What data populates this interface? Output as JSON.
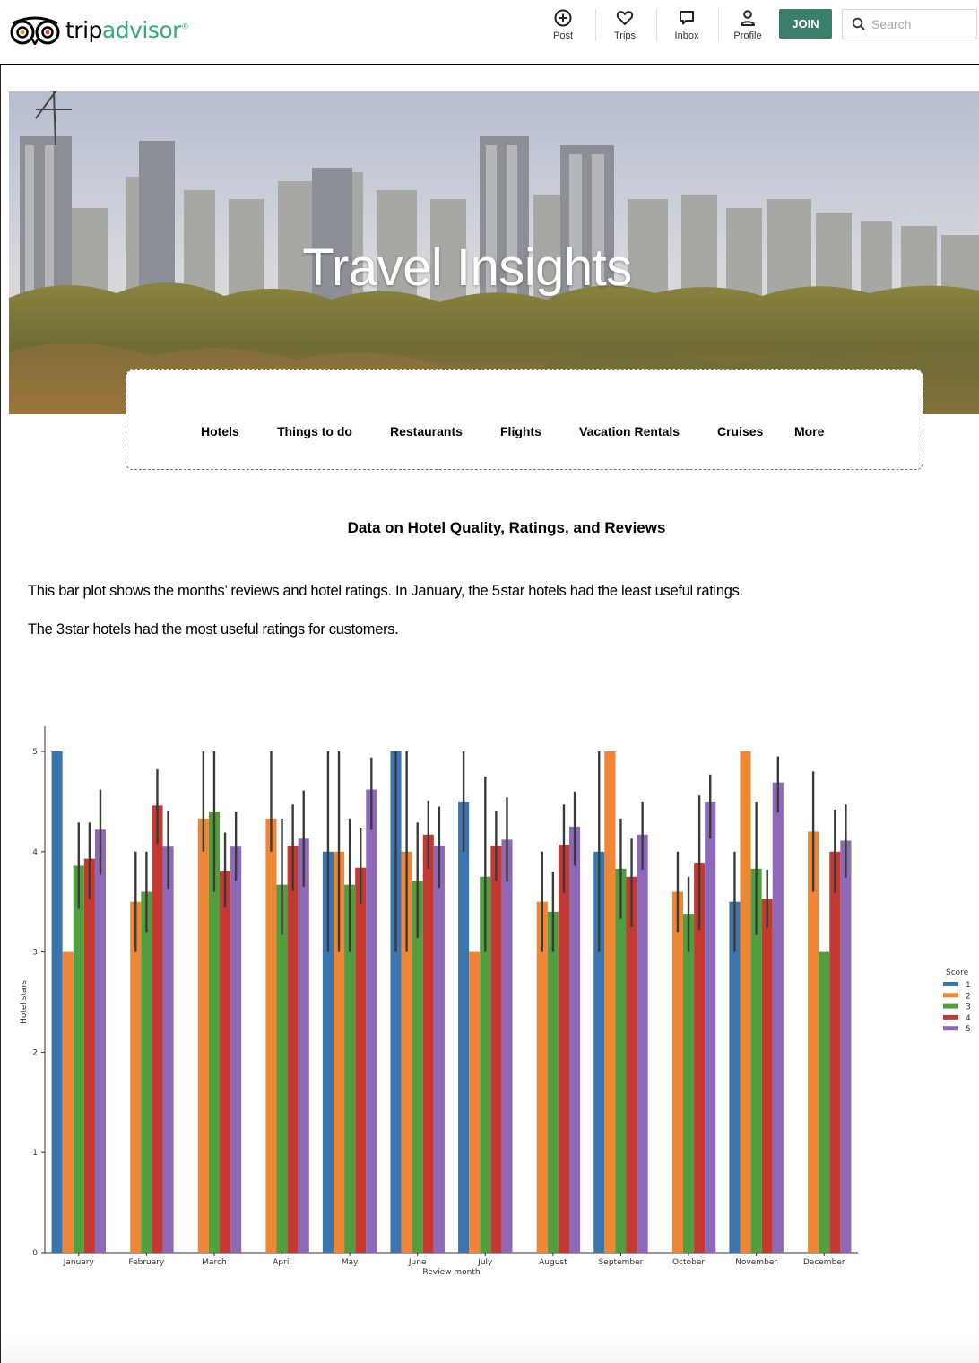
{
  "brand": {
    "name_part1": "trip",
    "name_part2": "advisor",
    "reg": "®"
  },
  "header": {
    "nav": [
      {
        "label": "Post",
        "icon": "post-plus-icon"
      },
      {
        "label": "Trips",
        "icon": "heart-icon"
      },
      {
        "label": "Inbox",
        "icon": "chat-icon"
      },
      {
        "label": "Profile",
        "icon": "user-icon"
      }
    ],
    "join_label": "JOIN",
    "search_placeholder": "Search"
  },
  "hero": {
    "title": "Travel Insights"
  },
  "categories": [
    "Hotels",
    "Things to do",
    "Restaurants",
    "Flights",
    "Vacation Rentals",
    "Cruises",
    "More"
  ],
  "section": {
    "title": "Data on Hotel Quality, Ratings, and Reviews",
    "para1": "This bar plot shows the months’ reviews and hotel ratings.  In January, the 5 star hotels had the least useful ratings.",
    "para2": "The 3 star hotels had the most useful ratings for customers."
  },
  "chart_data": {
    "type": "bar",
    "xlabel": "Review month",
    "ylabel": "Hotel stars",
    "ylim": [
      0,
      5
    ],
    "yticks": [
      0,
      1,
      2,
      3,
      4,
      5
    ],
    "legend_title": "Score",
    "legend_position": "right",
    "error_bars": true,
    "categories": [
      "January",
      "February",
      "March",
      "April",
      "May",
      "June",
      "July",
      "August",
      "September",
      "October",
      "November",
      "December"
    ],
    "series": [
      {
        "name": "1",
        "color": "#3b75af",
        "values": [
          5.0,
          null,
          null,
          null,
          4.0,
          5.0,
          4.5,
          null,
          4.0,
          null,
          3.5,
          null
        ],
        "err_low": [
          null,
          null,
          null,
          null,
          3.0,
          3.0,
          4.0,
          null,
          3.0,
          null,
          3.0,
          null
        ],
        "err_high": [
          null,
          null,
          null,
          null,
          5.0,
          5.0,
          5.0,
          null,
          5.0,
          null,
          4.0,
          null
        ]
      },
      {
        "name": "2",
        "color": "#ef8636",
        "values": [
          3.0,
          3.5,
          4.33,
          4.33,
          4.0,
          4.0,
          3.0,
          3.5,
          5.0,
          3.6,
          5.0,
          4.2
        ],
        "err_low": [
          null,
          3.0,
          4.0,
          4.0,
          3.0,
          3.0,
          null,
          3.0,
          null,
          3.2,
          null,
          3.6
        ],
        "err_high": [
          null,
          4.0,
          5.0,
          5.0,
          5.0,
          5.0,
          null,
          4.0,
          null,
          4.0,
          null,
          4.8
        ]
      },
      {
        "name": "3",
        "color": "#519e3e",
        "values": [
          3.86,
          3.6,
          4.4,
          3.67,
          3.67,
          3.71,
          3.75,
          3.4,
          3.83,
          3.38,
          3.83,
          3.0
        ],
        "err_low": [
          3.43,
          3.2,
          3.6,
          3.17,
          3.0,
          3.14,
          3.0,
          3.0,
          3.33,
          3.0,
          3.17,
          null
        ],
        "err_high": [
          4.29,
          4.0,
          5.0,
          4.33,
          4.33,
          4.29,
          4.75,
          3.8,
          4.33,
          3.75,
          4.5,
          null
        ]
      },
      {
        "name": "4",
        "color": "#c43a32",
        "values": [
          3.93,
          4.46,
          3.81,
          4.06,
          3.84,
          4.17,
          4.06,
          4.07,
          3.75,
          3.89,
          3.53,
          4.0
        ],
        "err_low": [
          3.53,
          4.08,
          3.44,
          3.61,
          3.48,
          3.83,
          3.71,
          3.59,
          3.25,
          3.22,
          3.24,
          3.59
        ],
        "err_high": [
          4.29,
          4.82,
          4.19,
          4.47,
          4.24,
          4.51,
          4.41,
          4.47,
          4.13,
          4.56,
          3.82,
          4.42
        ]
      },
      {
        "name": "5",
        "color": "#8d69b8",
        "values": [
          4.22,
          4.05,
          4.05,
          4.13,
          4.62,
          4.06,
          4.12,
          4.25,
          4.17,
          4.5,
          4.69,
          4.11
        ],
        "err_low": [
          3.77,
          3.63,
          3.71,
          3.65,
          4.22,
          3.64,
          3.7,
          3.86,
          3.82,
          4.13,
          4.39,
          3.74
        ],
        "err_high": [
          4.62,
          4.41,
          4.4,
          4.61,
          4.94,
          4.45,
          4.54,
          4.6,
          4.5,
          4.77,
          4.95,
          4.47
        ]
      }
    ]
  }
}
